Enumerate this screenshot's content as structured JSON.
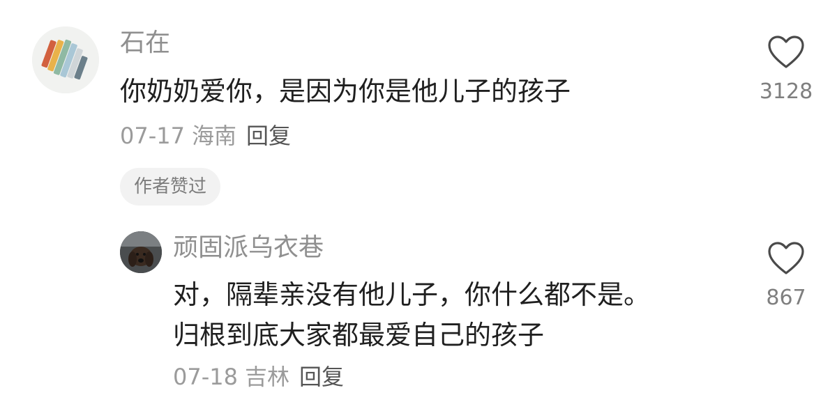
{
  "comments": [
    {
      "username": "石在",
      "avatar_icon": "colored-blocks-avatar",
      "text_lines": [
        "你奶奶爱你，是因为你是他儿子的孩子"
      ],
      "date": "07-17",
      "location": "海南",
      "reply_label": "回复",
      "badge": "作者赞过",
      "like_icon": "heart-outline-icon",
      "like_count": "3128"
    },
    {
      "username": "顽固派乌衣巷",
      "avatar_icon": "dog-photo-avatar",
      "text_lines": [
        "对，隔辈亲没有他儿子，你什么都不是。",
        "归根到底大家都最爱自己的孩子"
      ],
      "date": "07-18",
      "location": "吉林",
      "reply_label": "回复",
      "like_icon": "heart-outline-icon",
      "like_count": "867"
    }
  ],
  "colors": {
    "username": "#8f8f8f",
    "text": "#1f1f1f",
    "meta": "#9b9b9b",
    "badge_bg": "#f2f2f2"
  }
}
